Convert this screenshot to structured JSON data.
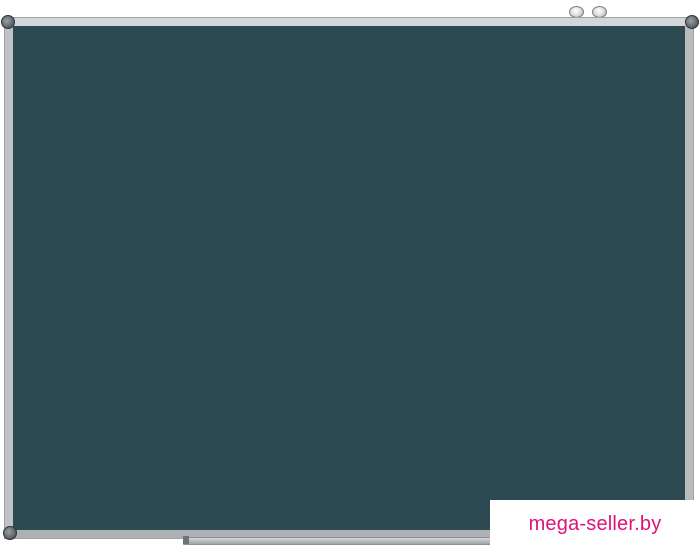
{
  "image": {
    "subject": "chalkboard",
    "board_color": "#2d4a52",
    "frame_color": "#c9ccce",
    "accent_color": "#e0117a"
  },
  "watermark": {
    "text": "mega-seller.by"
  }
}
